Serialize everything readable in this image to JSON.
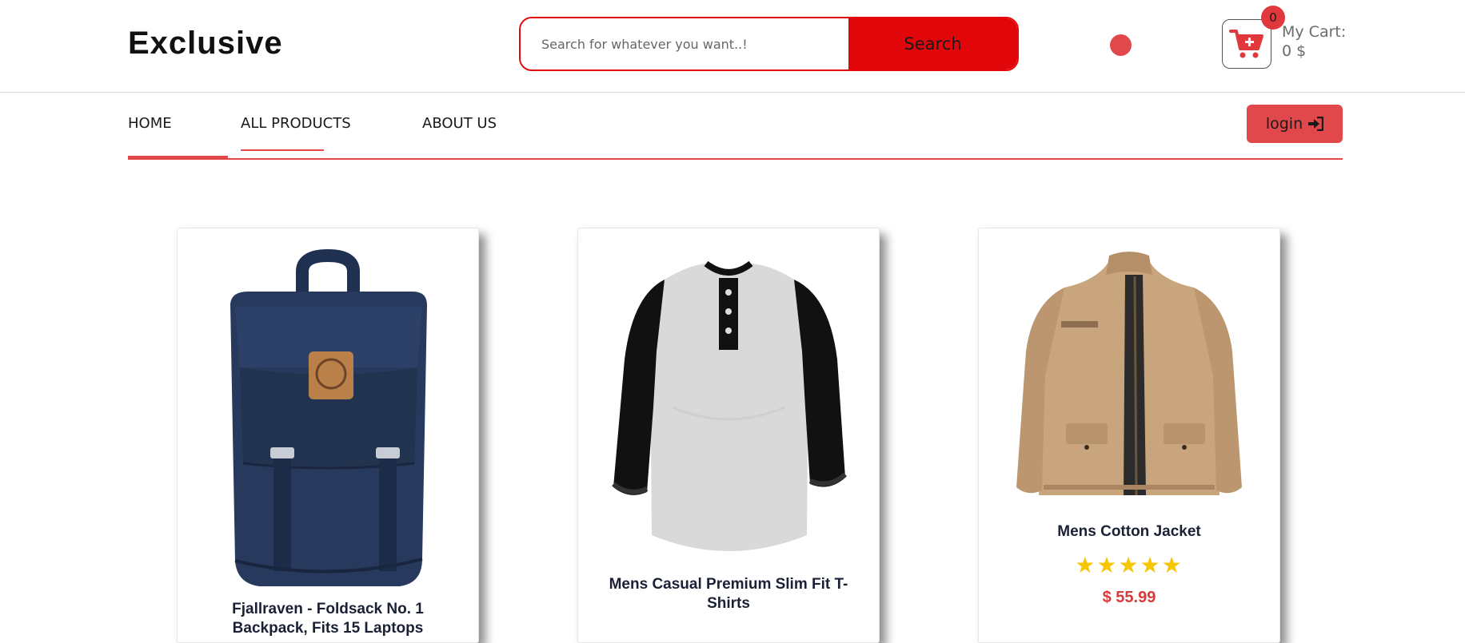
{
  "header": {
    "logo": "Exclusive",
    "search": {
      "placeholder": "Search for whatever you want..!",
      "button_label": "Search"
    },
    "cart": {
      "count": "0",
      "label": "My Cart:",
      "total": "0 $"
    },
    "accent_color": "#e0060a"
  },
  "nav": {
    "items": [
      {
        "label": "HOME"
      },
      {
        "label": "ALL PRODUCTS"
      },
      {
        "label": "ABOUT US"
      }
    ],
    "login_label": "login",
    "login_icon": "sign-in-icon"
  },
  "products": [
    {
      "title": "Fjallraven - Foldsack No. 1 Backpack, Fits 15 Laptops",
      "image": "backpack-image"
    },
    {
      "title": "Mens Casual Premium Slim Fit T-Shirts",
      "image": "tshirt-image"
    },
    {
      "title": "Mens Cotton Jacket",
      "image": "jacket-image",
      "rating": 5,
      "price": "$ 55.99"
    }
  ]
}
